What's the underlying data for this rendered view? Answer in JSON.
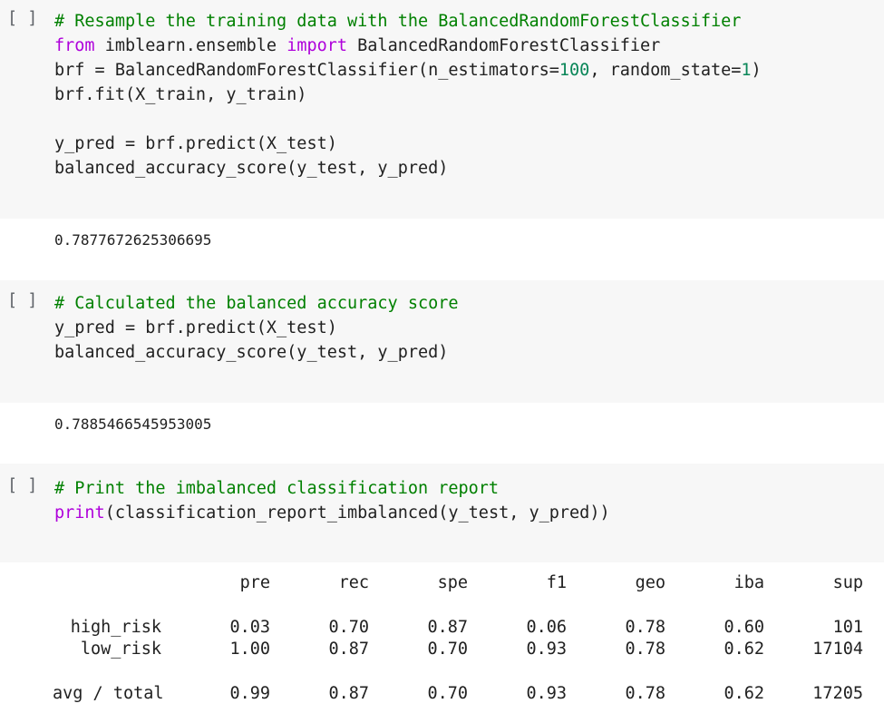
{
  "cells": [
    {
      "run_label": "[ ]",
      "lines": [
        {
          "comment": "# Resample the training data with the BalancedRandomForestClassifier"
        },
        {
          "kw1": "from",
          "t1": " imblearn.ensemble ",
          "kw2": "import",
          "t2": " BalancedRandomForestClassifier"
        },
        {
          "t1": "brf = BalancedRandomForestClassifier(n_estimators=",
          "n1": "100",
          "t2": ", random_state=",
          "n2": "1",
          "t3": ")"
        },
        {
          "t1": "brf.fit(X_train, y_train)"
        },
        {
          "t1": ""
        },
        {
          "t1": "y_pred = brf.predict(X_test)"
        },
        {
          "t1": "balanced_accuracy_score(y_test, y_pred)"
        }
      ],
      "output": "0.7877672625306695"
    },
    {
      "run_label": "[ ]",
      "lines": [
        {
          "comment": "# Calculated the balanced accuracy score"
        },
        {
          "t1": "y_pred = brf.predict(X_test)"
        },
        {
          "t1": "balanced_accuracy_score(y_test, y_pred)"
        }
      ],
      "output": "0.7885466545953005"
    },
    {
      "run_label": "[ ]",
      "lines": [
        {
          "comment": "# Print the imbalanced classification report"
        },
        {
          "kw1": "print",
          "t1": "(classification_report_imbalanced(y_test, y_pred))"
        }
      ]
    }
  ],
  "report": {
    "headers": [
      "pre",
      "rec",
      "spe",
      "f1",
      "geo",
      "iba",
      "sup"
    ],
    "rows": [
      {
        "label": "high_risk",
        "values": [
          "0.03",
          "0.70",
          "0.87",
          "0.06",
          "0.78",
          "0.60",
          "101"
        ]
      },
      {
        "label": "low_risk",
        "values": [
          "1.00",
          "0.87",
          "0.70",
          "0.93",
          "0.78",
          "0.62",
          "17104"
        ]
      },
      {
        "label": "avg / total",
        "values": [
          "0.99",
          "0.87",
          "0.70",
          "0.93",
          "0.78",
          "0.62",
          "17205"
        ]
      }
    ]
  },
  "colors": {
    "cell_background": "#f7f7f7",
    "comment": "#008000",
    "keyword": "#af00db",
    "number": "#098658"
  }
}
